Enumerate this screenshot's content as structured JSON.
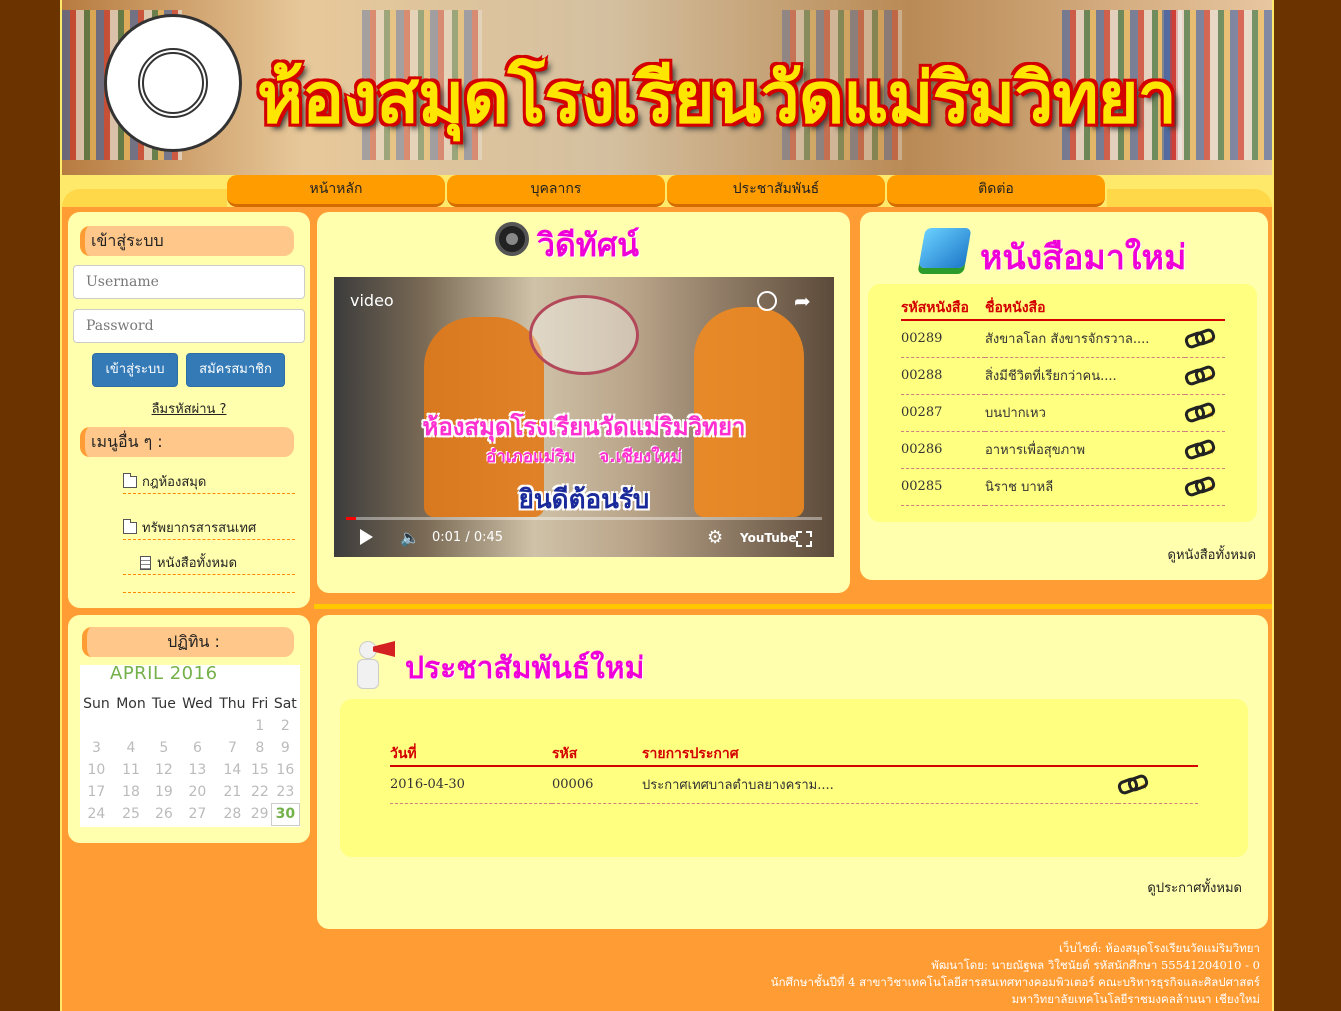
{
  "banner": {
    "title": "ห้องสมุดโรงเรียนวัดแม่ริมวิทยา"
  },
  "nav": {
    "items": [
      "หน้าหลัก",
      "บุคลากร",
      "ประชาสัมพันธ์",
      "ติดต่อ"
    ]
  },
  "login": {
    "header": "เข้าสู่ระบบ",
    "username_placeholder": "Username",
    "password_placeholder": "Password",
    "login_button": "เข้าสู่ระบบ",
    "register_button": "สมัครสมาชิก",
    "forgot_link": "ลืมรหัสผ่าน ?"
  },
  "menu": {
    "header": "เมนูอื่น ๆ :",
    "items": [
      "กฎห้องสมุด",
      "ทรัพยากรสารสนเทศ",
      "หนังสือทั้งหมด"
    ]
  },
  "calendar": {
    "header": "ปฏิทิน :",
    "title": "APRIL 2016",
    "weekdays": [
      "Sun",
      "Mon",
      "Tue",
      "Wed",
      "Thu",
      "Fri",
      "Sat"
    ],
    "today": "30"
  },
  "video": {
    "section_title": "วิดีทัศน์",
    "label": "video",
    "overlay_title": "ห้องสมุดโรงเรียนวัดแม่ริมวิทยา",
    "overlay_sub": "อำเภอแม่ริม    จ.เชียงใหม่",
    "overlay_welcome": "ยินดีต้อนรับ",
    "time": "0:01 / 0:45",
    "progress": 0.022,
    "youtube": "YouTube"
  },
  "new_books": {
    "section_title": "หนังสือมาใหม่",
    "col_id": "รหัสหนังสือ",
    "col_name": "ชื่อหนังสือ",
    "rows": [
      {
        "id": "00289",
        "name": "สังขาลโลก สังขารจักรวาล...."
      },
      {
        "id": "00288",
        "name": "สิ่งมีชีวิตที่เรียกว่าคน...."
      },
      {
        "id": "00287",
        "name": "บนปากเหว"
      },
      {
        "id": "00286",
        "name": "อาหารเพื่อสุขภาพ"
      },
      {
        "id": "00285",
        "name": "นิราช บาหลี"
      }
    ],
    "view_all": "ดูหนังสือทั้งหมด"
  },
  "news": {
    "section_title": "ประชาสัมพันธ์ใหม่",
    "col_date": "วันที่",
    "col_id": "รหัส",
    "col_title": "รายการประกาศ",
    "rows": [
      {
        "date": "2016-04-30",
        "id": "00006",
        "title": "ประกาศเทศบาลตำบลยางคราม...."
      }
    ],
    "view_all": "ดูประกาศทั้งหมด"
  },
  "footer": {
    "line1": "เว็บไซต์: ห้องสมุดโรงเรียนวัดแม่ริมวิทยา",
    "line2": "พัฒนาโดย: นายณัฐพล วิใชนัยต์ รหัสนักศึกษา 55541204010 - 0",
    "line3": "นักศึกษาชั้นปีที่ 4 สาขาวิชาเทคโนโลยีสารสนเทศทางคอมพิวเตอร์ คณะบริหารธุรกิจและศิลปศาสตร์",
    "line4": "มหาวิทยาลัยเทคโนโลยีราชมงคลล้านนา เชียงใหม่"
  },
  "colors": {
    "accent": "#ff9c33",
    "panel": "#ffffad",
    "title_magenta": "#f000d8",
    "header_red": "#d40000"
  }
}
